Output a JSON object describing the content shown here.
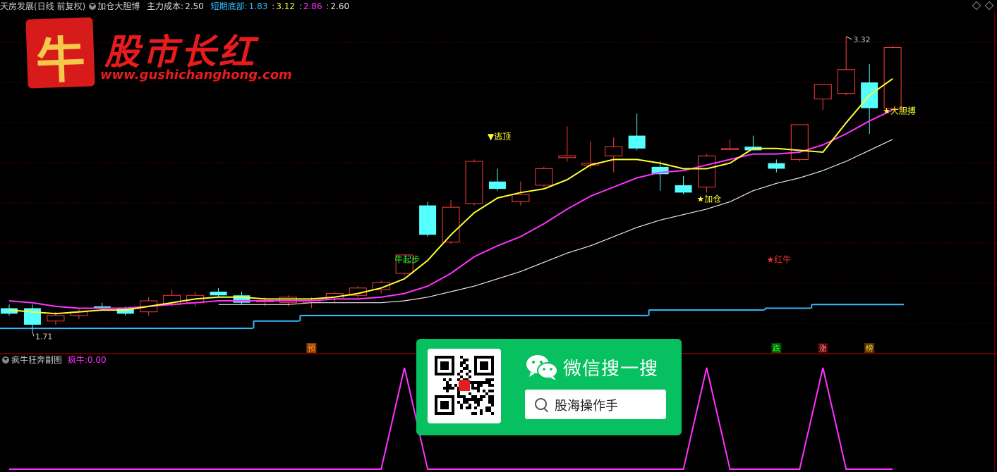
{
  "header": {
    "stock_name": "天房发展(日线 前复权)",
    "indicator_name": "加仓大胆博",
    "main_cost_label": "主力成本:",
    "main_cost_value": "2.50",
    "short_bottom_label": "短期底部:",
    "short_bottom_value": "1.83",
    "sep1": ":",
    "value2": "3.12",
    "sep2": ":",
    "value3": "2.86",
    "sep3": ":",
    "value4": "2.60"
  },
  "sub_header": {
    "panel_name": "疯牛狂奔副图",
    "series_label": "疯牛:",
    "series_value": "0.00"
  },
  "watermark": {
    "logo_char": "牛",
    "brand": "股市长红",
    "url": "www.gushichanghong.com"
  },
  "wechat_banner": {
    "title": "微信搜一搜",
    "query": "股海操作手"
  },
  "colors": {
    "up": "#ff3c3c",
    "down": "#54ffff",
    "ma_fast": "#ffff33",
    "ma_mid": "#ff33ff",
    "ma_slow": "#e8e8e8",
    "base": "#33bbff",
    "signal": "#ff33ff",
    "grid": "#8b0000"
  },
  "chart_data": [
    {
      "type": "candlestick",
      "y_range": [
        1.6,
        3.45
      ],
      "grid": true,
      "candles": [
        {
          "o": 1.84,
          "h": 1.86,
          "l": 1.8,
          "c": 1.81
        },
        {
          "o": 1.84,
          "h": 1.86,
          "l": 1.71,
          "c": 1.75
        },
        {
          "o": 1.77,
          "h": 1.82,
          "l": 1.75,
          "c": 1.8
        },
        {
          "o": 1.8,
          "h": 1.84,
          "l": 1.78,
          "c": 1.82
        },
        {
          "o": 1.85,
          "h": 1.87,
          "l": 1.83,
          "c": 1.84
        },
        {
          "o": 1.84,
          "h": 1.85,
          "l": 1.8,
          "c": 1.81
        },
        {
          "o": 1.82,
          "h": 1.9,
          "l": 1.8,
          "c": 1.88
        },
        {
          "o": 1.86,
          "h": 1.94,
          "l": 1.85,
          "c": 1.91
        },
        {
          "o": 1.87,
          "h": 1.93,
          "l": 1.85,
          "c": 1.91
        },
        {
          "o": 1.93,
          "h": 1.95,
          "l": 1.9,
          "c": 1.91
        },
        {
          "o": 1.91,
          "h": 1.93,
          "l": 1.86,
          "c": 1.87
        },
        {
          "o": 1.88,
          "h": 1.9,
          "l": 1.85,
          "c": 1.88
        },
        {
          "o": 1.87,
          "h": 1.91,
          "l": 1.85,
          "c": 1.9
        },
        {
          "o": 1.87,
          "h": 1.9,
          "l": 1.84,
          "c": 1.88
        },
        {
          "o": 1.89,
          "h": 1.93,
          "l": 1.87,
          "c": 1.92
        },
        {
          "o": 1.91,
          "h": 1.96,
          "l": 1.89,
          "c": 1.95
        },
        {
          "o": 1.94,
          "h": 1.99,
          "l": 1.92,
          "c": 1.98
        },
        {
          "o": 2.03,
          "h": 2.13,
          "l": 2.02,
          "c": 2.13
        },
        {
          "o": 2.4,
          "h": 2.42,
          "l": 2.23,
          "c": 2.24
        },
        {
          "o": 2.2,
          "h": 2.43,
          "l": 2.19,
          "c": 2.39
        },
        {
          "o": 2.41,
          "h": 2.65,
          "l": 2.4,
          "c": 2.64
        },
        {
          "o": 2.53,
          "h": 2.6,
          "l": 2.48,
          "c": 2.49
        },
        {
          "o": 2.42,
          "h": 2.53,
          "l": 2.4,
          "c": 2.46
        },
        {
          "o": 2.51,
          "h": 2.61,
          "l": 2.5,
          "c": 2.6
        },
        {
          "o": 2.66,
          "h": 2.83,
          "l": 2.64,
          "c": 2.67
        },
        {
          "o": 2.62,
          "h": 2.75,
          "l": 2.6,
          "c": 2.63
        },
        {
          "o": 2.67,
          "h": 2.77,
          "l": 2.58,
          "c": 2.72
        },
        {
          "o": 2.78,
          "h": 2.9,
          "l": 2.7,
          "c": 2.71
        },
        {
          "o": 2.61,
          "h": 2.64,
          "l": 2.48,
          "c": 2.57
        },
        {
          "o": 2.51,
          "h": 2.56,
          "l": 2.46,
          "c": 2.47
        },
        {
          "o": 2.5,
          "h": 2.68,
          "l": 2.47,
          "c": 2.67
        },
        {
          "o": 2.71,
          "h": 2.76,
          "l": 2.7,
          "c": 2.71
        },
        {
          "o": 2.72,
          "h": 2.78,
          "l": 2.71,
          "c": 2.7
        },
        {
          "o": 2.63,
          "h": 2.65,
          "l": 2.58,
          "c": 2.6
        },
        {
          "o": 2.65,
          "h": 2.84,
          "l": 2.64,
          "c": 2.84
        },
        {
          "o": 2.98,
          "h": 3.05,
          "l": 2.92,
          "c": 3.06
        },
        {
          "o": 3.01,
          "h": 3.32,
          "l": 3.0,
          "c": 3.14
        },
        {
          "o": 3.07,
          "h": 3.17,
          "l": 2.79,
          "c": 2.93
        },
        {
          "o": 2.93,
          "h": 3.27,
          "l": 2.92,
          "c": 3.26
        }
      ],
      "ma_fast": [
        1.83,
        1.82,
        1.81,
        1.82,
        1.83,
        1.83,
        1.85,
        1.87,
        1.89,
        1.9,
        1.9,
        1.89,
        1.89,
        1.89,
        1.9,
        1.92,
        1.95,
        2.0,
        2.1,
        2.24,
        2.36,
        2.44,
        2.47,
        2.49,
        2.54,
        2.62,
        2.65,
        2.65,
        2.63,
        2.6,
        2.6,
        2.63,
        2.71,
        2.71,
        2.7,
        2.69,
        2.85,
        3.0,
        3.09
      ],
      "ma_mid": [
        1.88,
        1.87,
        1.85,
        1.84,
        1.84,
        1.84,
        1.85,
        1.86,
        1.87,
        1.88,
        1.88,
        1.88,
        1.88,
        1.88,
        1.89,
        1.89,
        1.9,
        1.92,
        1.96,
        2.03,
        2.12,
        2.18,
        2.23,
        2.3,
        2.38,
        2.45,
        2.5,
        2.55,
        2.58,
        2.59,
        2.62,
        2.65,
        2.68,
        2.68,
        2.69,
        2.73,
        2.79,
        2.86,
        2.92
      ],
      "ma_slow": [
        null,
        null,
        null,
        null,
        null,
        null,
        null,
        null,
        null,
        1.86,
        1.86,
        1.86,
        1.86,
        1.87,
        1.87,
        1.87,
        1.87,
        1.88,
        1.9,
        1.93,
        1.96,
        2.0,
        2.04,
        2.09,
        2.14,
        2.18,
        2.23,
        2.28,
        2.32,
        2.35,
        2.38,
        2.42,
        2.48,
        2.52,
        2.55,
        2.59,
        2.64,
        2.7,
        2.76
      ],
      "base_line": [
        {
          "x0": 0,
          "x1": 10,
          "y": 1.73
        },
        {
          "x0": 11,
          "x1": 12,
          "y": 1.77
        },
        {
          "x0": 13,
          "x1": 27,
          "y": 1.8
        },
        {
          "x0": 28,
          "x1": 32,
          "y": 1.83
        },
        {
          "x0": 33,
          "x1": 34,
          "y": 1.84
        },
        {
          "x0": 35,
          "x1": 38,
          "y": 1.86
        }
      ],
      "annotations": [
        {
          "text": "3.32",
          "i": 36,
          "y": 3.32,
          "kind": "price",
          "color": "#c8c8c8"
        },
        {
          "text": "1.71",
          "i": 1,
          "y": 1.71,
          "kind": "price",
          "color": "#c8c8c8"
        },
        {
          "text": "▼逃顶",
          "i": 21,
          "y": 2.76,
          "color": "#ffff33"
        },
        {
          "text": "★大胆搏",
          "i": 38,
          "y": 2.9,
          "color": "#ffff33"
        },
        {
          "text": "★加仓",
          "i": 30,
          "y": 2.42,
          "color": "#ffff33"
        },
        {
          "text": "牛起步",
          "i": 17,
          "y": 2.09,
          "color": "#33ff33"
        },
        {
          "text": "★红牛",
          "i": 33,
          "y": 2.09,
          "color": "#ff3333"
        }
      ],
      "bottom_tags": [
        {
          "text": "预",
          "i": 13,
          "bg": "#8b3a00",
          "fg": "#ff9933"
        },
        {
          "text": "跌",
          "i": 33,
          "bg": "#005500",
          "fg": "#33ff33"
        },
        {
          "text": "涨",
          "i": 35,
          "bg": "#550000",
          "fg": "#ff9999"
        },
        {
          "text": "榜",
          "i": 37,
          "bg": "#553300",
          "fg": "#ffcc33"
        }
      ]
    },
    {
      "type": "line",
      "series": [
        {
          "name": "疯牛",
          "points": [
            [
              0,
              0
            ],
            [
              16,
              0
            ],
            [
              17,
              1
            ],
            [
              18,
              0
            ],
            [
              29,
              0
            ],
            [
              30,
              1
            ],
            [
              31,
              0
            ],
            [
              34,
              0
            ],
            [
              35,
              1
            ],
            [
              36,
              0
            ],
            [
              38,
              0
            ]
          ]
        }
      ],
      "y_range": [
        0,
        1
      ]
    }
  ]
}
